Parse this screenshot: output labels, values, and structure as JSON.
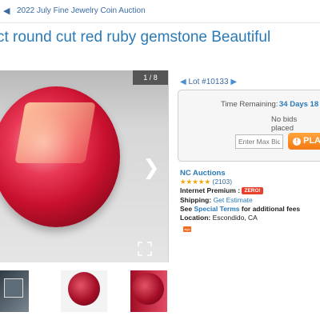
{
  "breadcrumb": {
    "label": "2022 July Fine Jewelry Coin Auction"
  },
  "title": "ct round cut red ruby gemstone Beautiful",
  "gallery": {
    "counter": "1 / 8",
    "next_icon": "chevron-right-icon",
    "expand_icon": "expand-icon"
  },
  "lot": {
    "label": "Lot #10133"
  },
  "bid": {
    "time_remaining_label": "Time Remaining:",
    "time_remaining_value": "34 Days 18 H",
    "status": "No bids placed",
    "max_bid_placeholder": "Enter Max Bid",
    "place_label": "PLA",
    "place_icon": "!"
  },
  "seller": {
    "name": "NC Auctions",
    "stars": "★★★★★",
    "rating_count": "(2103)",
    "internet_premium_label": "Internet Premium :",
    "internet_premium_badge": "ZERO!",
    "shipping_label": "Shipping:",
    "shipping_value": "Get Estimate",
    "terms_prefix": "See",
    "terms_link": "Special Terms",
    "terms_suffix": "for additional fees",
    "location_label": "Location:",
    "location_value": "Escondido, CA",
    "badge_text": "sign"
  },
  "colors": {
    "accent": "#2a7ab8",
    "button": "#f47a14",
    "ruby": "#c8102e"
  }
}
